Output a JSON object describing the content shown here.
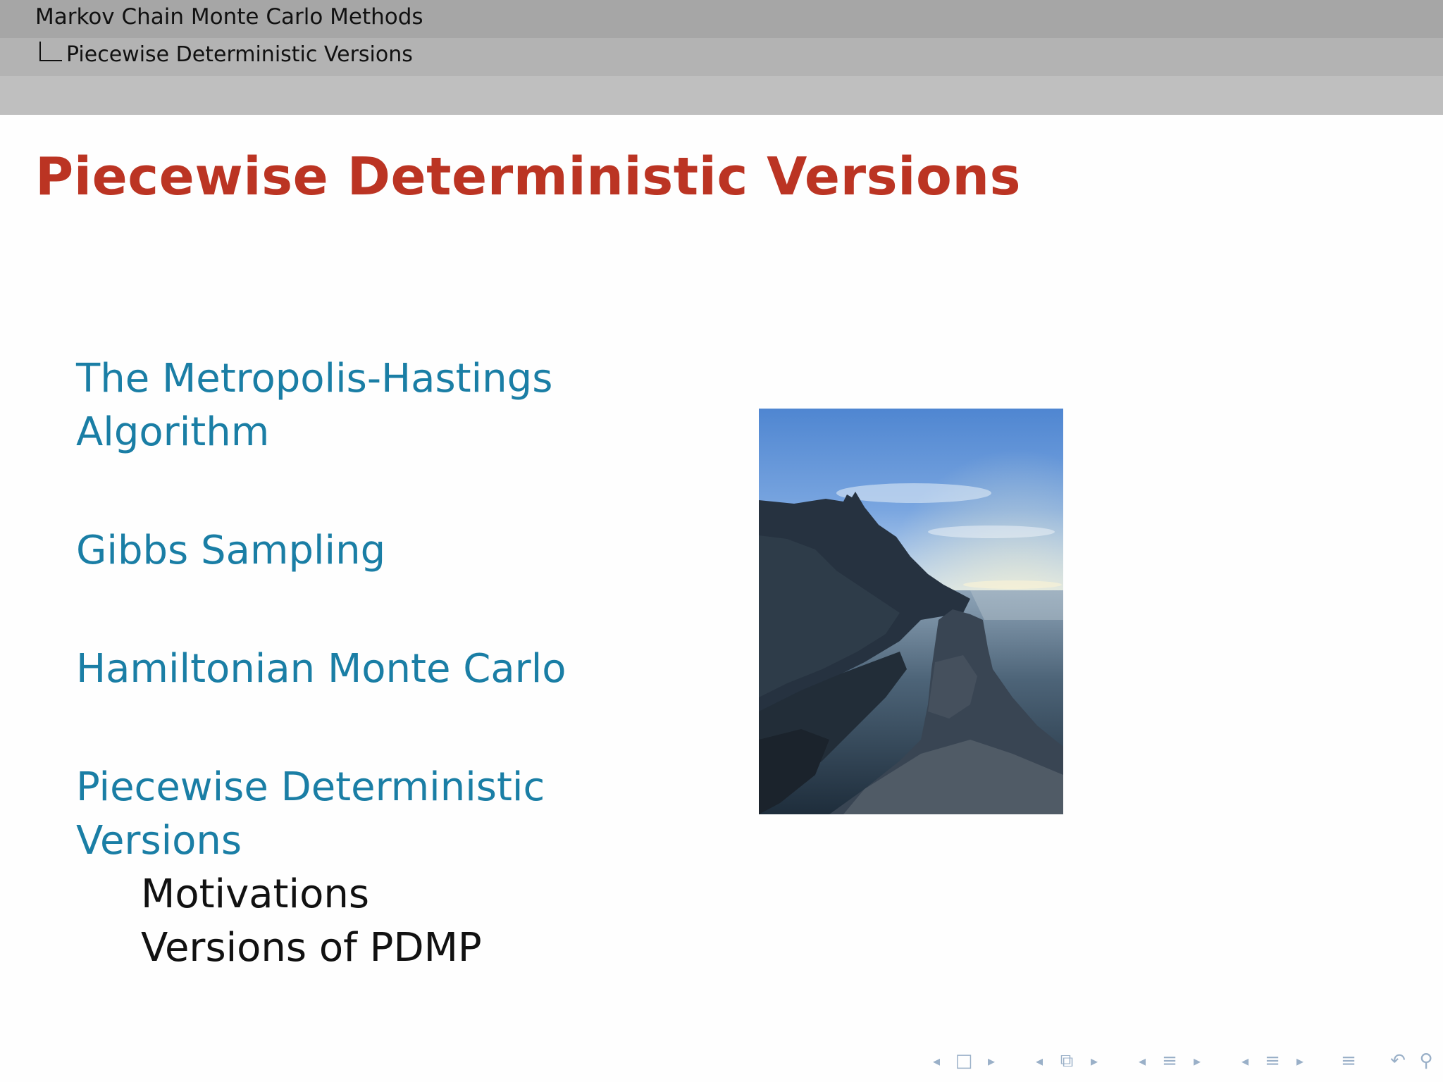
{
  "header": {
    "title": "Markov Chain Monte Carlo Methods",
    "subtitle": "Piecewise Deterministic Versions"
  },
  "frame": {
    "title": "Piecewise Deterministic Versions"
  },
  "toc": {
    "sections": [
      {
        "label": "The Metropolis-Hastings Algorithm",
        "line1": "The Metropolis-Hastings",
        "line2": "Algorithm"
      },
      {
        "label": "Gibbs Sampling"
      },
      {
        "label": "Hamiltonian Monte Carlo"
      },
      {
        "label": "Piecewise Deterministic Versions",
        "subsections": [
          "Motivations",
          "Versions of PDMP"
        ]
      }
    ]
  },
  "colors": {
    "title": "#bb3423",
    "section": "#1a7ea5",
    "subsection": "#111111",
    "header_band": "#a6a6a6"
  },
  "navigation": {
    "icons": [
      "nav-prev-slide",
      "nav-slide",
      "nav-next-slide",
      "nav-prev-frame",
      "nav-frame",
      "nav-next-frame",
      "nav-prev-subsection",
      "nav-subsection",
      "nav-next-subsection",
      "nav-prev-section",
      "nav-section",
      "nav-next-section",
      "nav-toc",
      "nav-back",
      "nav-search",
      "nav-forward"
    ]
  }
}
